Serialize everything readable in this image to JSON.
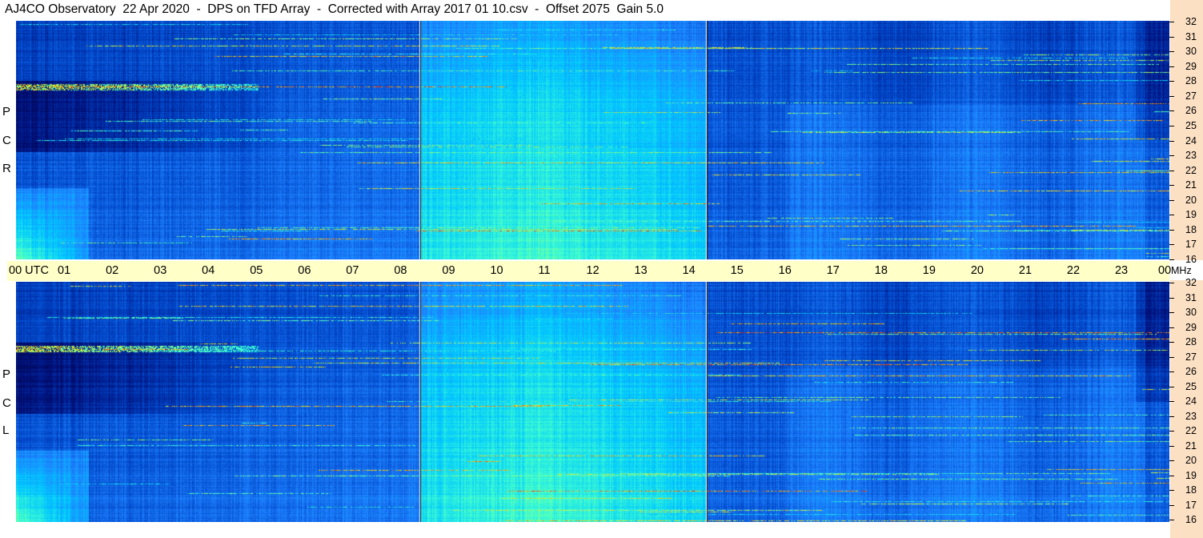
{
  "title": "AJ4CO Observatory  22 Apr 2020  -  DPS on TFD Array  -  Corrected with Array 2017 01 10.csv  -  Offset 2075  Gain 5.0",
  "time_axis": {
    "ticks": [
      "00  UTC",
      "01",
      "02",
      "03",
      "04",
      "05",
      "06",
      "07",
      "08",
      "09",
      "10",
      "11",
      "12",
      "13",
      "14",
      "15",
      "16",
      "17",
      "18",
      "19",
      "20",
      "21",
      "22",
      "23",
      "00"
    ],
    "unit": "MHz"
  },
  "panels": {
    "top": {
      "label": [
        "R",
        "C",
        "P"
      ]
    },
    "bottom": {
      "label": [
        "L",
        "C",
        "P"
      ]
    }
  },
  "frequency_axis": {
    "labels": [
      "32",
      "31",
      "30",
      "29",
      "28",
      "27",
      "26",
      "25",
      "24",
      "23",
      "22",
      "21",
      "20",
      "19",
      "18",
      "17",
      "16"
    ]
  },
  "colors": {
    "title_bg": "#ffffff",
    "axis_strip": "#ffffc8",
    "mhz_strip": "#fce0c4",
    "colormap": [
      "#000033",
      "#00107a",
      "#0046c8",
      "#1e82ff",
      "#00c8ff",
      "#40ffd0",
      "#c8ff40",
      "#ffb000",
      "#ff2000"
    ]
  },
  "chart_data": {
    "type": "heatmap",
    "title": "AJ4CO Observatory  22 Apr 2020  -  DPS on TFD Array  -  Corrected with Array 2017 01 10.csv  -  Offset 2075  Gain 5.0",
    "xlabel": "UTC",
    "ylabel": "MHz",
    "xlim": [
      0,
      24
    ],
    "ylim": [
      16,
      32
    ],
    "panels": [
      "RCP",
      "LCP"
    ],
    "data_gaps_utc": [
      8.4,
      14.35
    ]
  }
}
